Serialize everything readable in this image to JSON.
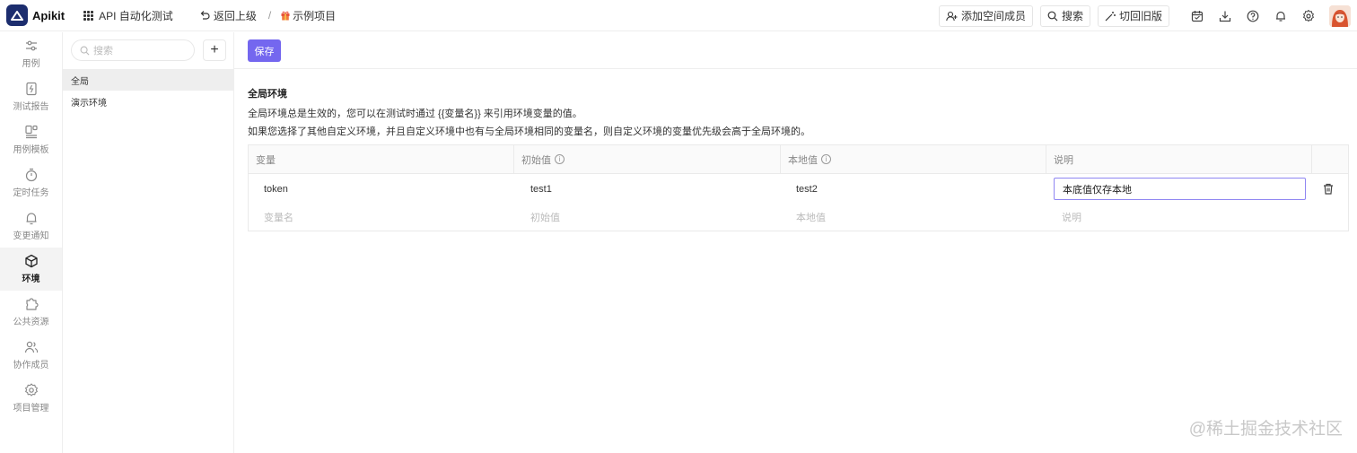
{
  "app": {
    "name": "Apikit"
  },
  "header": {
    "workspace": "API 自动化测试",
    "back_label": "返回上级",
    "separator": "/",
    "project": "示例项目",
    "add_member": "添加空间成员",
    "search": "搜索",
    "switch_old": "切回旧版",
    "icons": [
      "calendar-icon",
      "download-icon",
      "help-icon",
      "bell-icon",
      "gear-icon"
    ]
  },
  "nav": {
    "items": [
      {
        "label": "用例",
        "icon": "sliders-icon"
      },
      {
        "label": "测试报告",
        "icon": "report-icon"
      },
      {
        "label": "用例模板",
        "icon": "template-icon"
      },
      {
        "label": "定时任务",
        "icon": "timer-icon"
      },
      {
        "label": "变更通知",
        "icon": "bell-icon"
      },
      {
        "label": "环境",
        "icon": "cube-icon",
        "active": true
      },
      {
        "label": "公共资源",
        "icon": "puzzle-icon"
      },
      {
        "label": "协作成员",
        "icon": "users-icon"
      },
      {
        "label": "项目管理",
        "icon": "settings-icon"
      }
    ]
  },
  "env_panel": {
    "search_placeholder": "搜索",
    "add": "+",
    "items": [
      {
        "label": "全局",
        "active": true
      },
      {
        "label": "演示环境"
      }
    ]
  },
  "main": {
    "save": "保存",
    "title": "全局环境",
    "desc1": "全局环境总是生效的，您可以在测试时通过 {{变量名}} 来引用环境变量的值。",
    "desc2": "如果您选择了其他自定义环境，并且自定义环境中也有与全局环境相同的变量名，则自定义环境的变量优先级会高于全局环境的。",
    "columns": [
      "变量",
      "初始值",
      "本地值",
      "说明"
    ],
    "rows": [
      {
        "name": "token",
        "initial": "test1",
        "local": "test2",
        "note": "本底值仅存本地"
      }
    ],
    "placeholders": {
      "name": "变量名",
      "initial": "初始值",
      "local": "本地值",
      "note": "说明"
    }
  },
  "watermark": "@稀土掘金技术社区",
  "colors": {
    "accent": "#7467ef",
    "logo": "#1c2d6e"
  }
}
